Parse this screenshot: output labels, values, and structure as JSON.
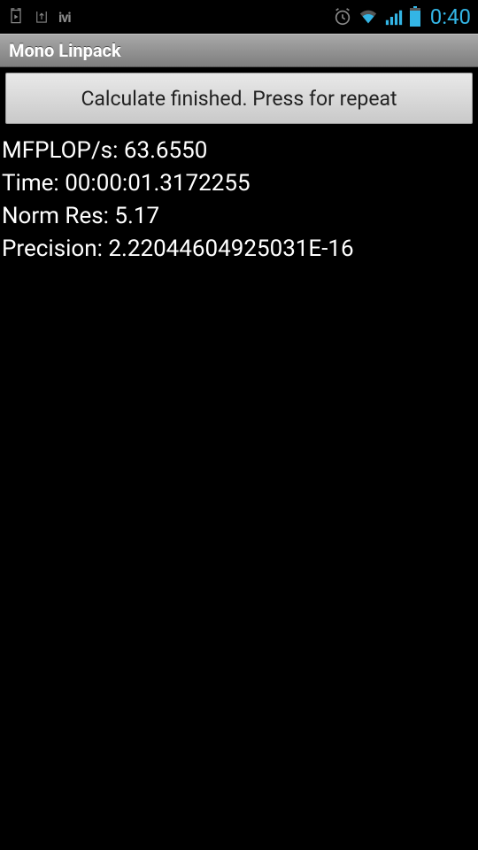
{
  "status_bar": {
    "clock": "0:40"
  },
  "title_bar": {
    "title": "Mono Linpack"
  },
  "button": {
    "label": "Calculate finished. Press for repeat"
  },
  "results": {
    "mflops_label": "MFPLOP/s:",
    "mflops_value": "63.6550",
    "time_label": "Time:",
    "time_value": "00:00:01.3172255",
    "norm_label": "Norm Res:",
    "norm_value": "5.17",
    "precision_label": "Precision:",
    "precision_value": "2.22044604925031E-16"
  }
}
